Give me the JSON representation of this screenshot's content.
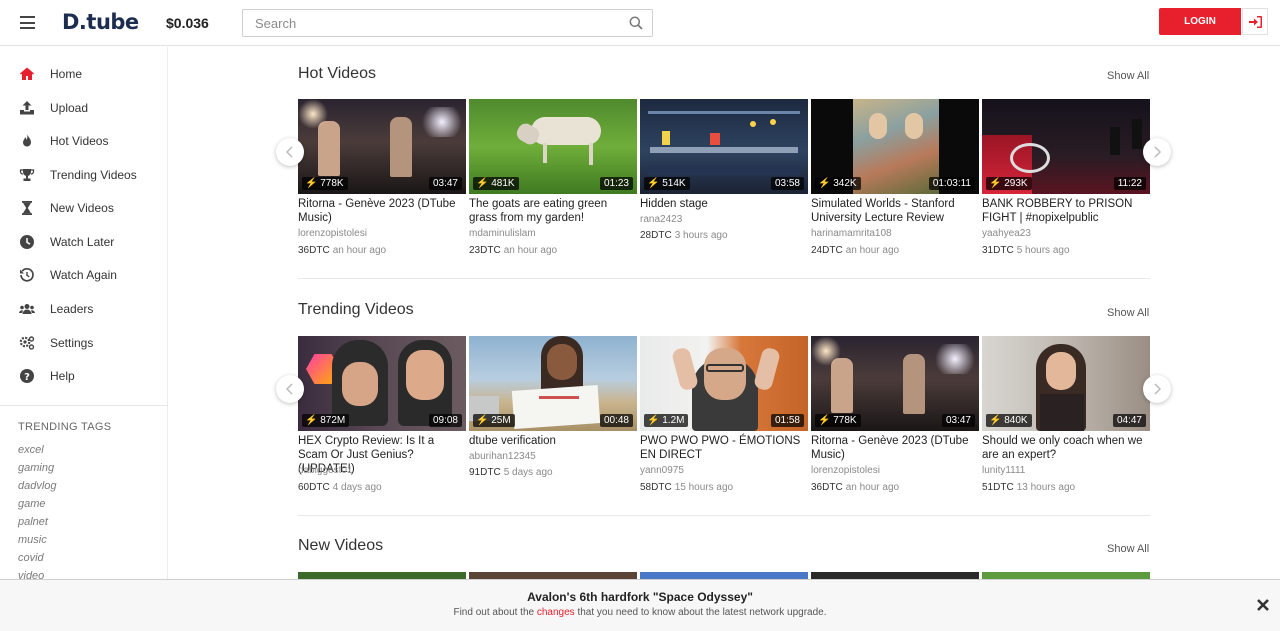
{
  "header": {
    "logo": "D.tube",
    "price": "$0.036",
    "search_placeholder": "Search",
    "login_label": "LOGIN"
  },
  "sidebar": {
    "items": [
      {
        "label": "Home",
        "icon": "home-icon"
      },
      {
        "label": "Upload",
        "icon": "upload-icon"
      },
      {
        "label": "Hot Videos",
        "icon": "fire-icon"
      },
      {
        "label": "Trending Videos",
        "icon": "trophy-icon"
      },
      {
        "label": "New Videos",
        "icon": "hourglass-icon"
      },
      {
        "label": "Watch Later",
        "icon": "clock-icon"
      },
      {
        "label": "Watch Again",
        "icon": "history-icon"
      },
      {
        "label": "Leaders",
        "icon": "users-icon"
      },
      {
        "label": "Settings",
        "icon": "gear-icon"
      },
      {
        "label": "Help",
        "icon": "help-icon"
      }
    ],
    "tags_title": "TRENDING TAGS",
    "tags": [
      "excel",
      "gaming",
      "dadvlog",
      "game",
      "palnet",
      "music",
      "covid",
      "video"
    ]
  },
  "sections": [
    {
      "title": "Hot Videos",
      "show_all": "Show All",
      "videos": [
        {
          "title": "Ritorna - Genève 2023 (DTube Music)",
          "author": "lorenzopistolesi",
          "dtc": "36DTC",
          "ago": "an hour ago",
          "views": "778K",
          "duration": "03:47"
        },
        {
          "title": "The goats are eating green grass from my garden!",
          "author": "mdaminulislam",
          "dtc": "23DTC",
          "ago": "an hour ago",
          "views": "481K",
          "duration": "01:23"
        },
        {
          "title": "Hidden stage",
          "author": "rana2423",
          "dtc": "28DTC",
          "ago": "3 hours ago",
          "views": "514K",
          "duration": "03:58"
        },
        {
          "title": "Simulated Worlds - Stanford University Lecture Review",
          "author": "harinamamrita108",
          "dtc": "24DTC",
          "ago": "an hour ago",
          "views": "342K",
          "duration": "01:03:11"
        },
        {
          "title": "BANK ROBBERY to PRISON FIGHT | #nopixelpublic",
          "author": "yaahyea23",
          "dtc": "31DTC",
          "ago": "5 hours ago",
          "views": "293K",
          "duration": "11:22"
        }
      ]
    },
    {
      "title": "Trending Videos",
      "show_all": "Show All",
      "videos": [
        {
          "title": "HEX Crypto Review: Is It a Scam Or Just Genius? (UPDATE!)",
          "author": "dabiggest01",
          "dtc": "60DTC",
          "ago": "4 days ago",
          "views": "872M",
          "duration": "09:08"
        },
        {
          "title": "dtube verification",
          "author": "aburihan12345",
          "dtc": "91DTC",
          "ago": "5 days ago",
          "views": "25M",
          "duration": "00:48"
        },
        {
          "title": "PWO PWO PWO - ÉMOTIONS EN DIRECT",
          "author": "yann0975",
          "dtc": "58DTC",
          "ago": "15 hours ago",
          "views": "1.2M",
          "duration": "01:58"
        },
        {
          "title": "Ritorna - Genève 2023 (DTube Music)",
          "author": "lorenzopistolesi",
          "dtc": "36DTC",
          "ago": "an hour ago",
          "views": "778K",
          "duration": "03:47"
        },
        {
          "title": "Should we only coach when we are an expert?",
          "author": "lunity1111",
          "dtc": "51DTC",
          "ago": "13 hours ago",
          "views": "840K",
          "duration": "04:47"
        }
      ]
    },
    {
      "title": "New Videos",
      "show_all": "Show All",
      "videos": []
    }
  ],
  "banner": {
    "title": "Avalon's 6th hardfork \"Space Odyssey\"",
    "text_before": "Find out about the ",
    "link": "changes",
    "text_after": " that you need to know about the latest network upgrade."
  },
  "colors": {
    "accent": "#e8202d",
    "logo": "#1d2d4f"
  }
}
